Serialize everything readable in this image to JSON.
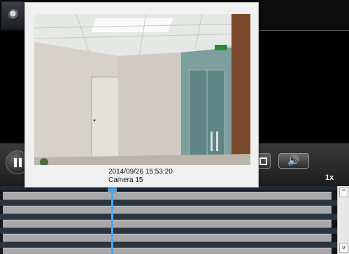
{
  "colors": {
    "accent_cursor": "#4aa8f0",
    "track_fill": "#a8a8a8",
    "popup_bg": "#f0f0f0",
    "control_bar": "#2a2a2a"
  },
  "icons": {
    "camera": "camera-icon",
    "pause": "pause-icon",
    "snapshot": "snapshot-icon",
    "sound": "speaker-icon",
    "scroll_up": "chevron-up-icon",
    "scroll_down": "chevron-down-icon"
  },
  "controls": {
    "speed_label": "1x",
    "sound_glyph": "🔊"
  },
  "scrollbar": {
    "up_glyph": "^",
    "down_glyph": "v"
  },
  "preview": {
    "timestamp": "2014/09/26 15:53:20",
    "camera_name": "Camera 15"
  },
  "timeline": {
    "track_count": 5
  }
}
